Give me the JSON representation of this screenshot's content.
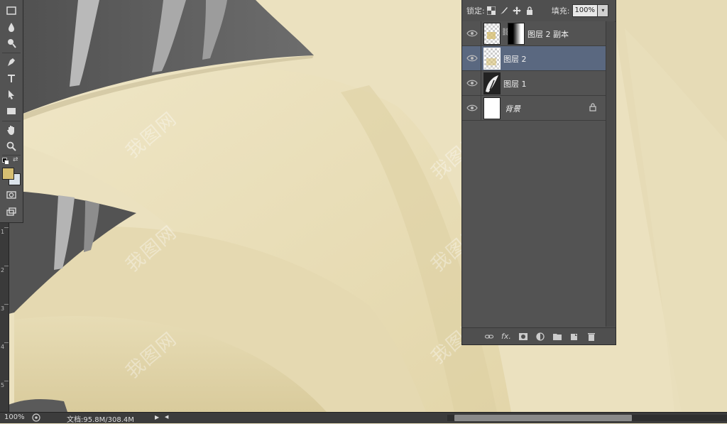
{
  "app": "Photoshop",
  "toolbox": {
    "tools": [
      {
        "name": "rectangle-marquee",
        "glyph": "▭"
      },
      {
        "name": "blur-drop",
        "glyph": "●"
      },
      {
        "name": "dodge",
        "glyph": "◔"
      },
      {
        "name": "pen",
        "glyph": "✒"
      },
      {
        "name": "type",
        "glyph": "T"
      },
      {
        "name": "path-selection",
        "glyph": "➤"
      },
      {
        "name": "rectangle-shape",
        "glyph": "■"
      },
      {
        "name": "hand",
        "glyph": "✋"
      },
      {
        "name": "zoom",
        "glyph": "⚲"
      }
    ],
    "foreground_color": "#d7bf72",
    "background_color": "#dbe3ea"
  },
  "layers_panel": {
    "lock_label": "锁定:",
    "fill_label": "填充:",
    "fill_value": "100%",
    "layers": [
      {
        "name": "图层 2 副本",
        "visible": true,
        "selected": false,
        "has_mask": true,
        "italic": false,
        "locked": false
      },
      {
        "name": "图层 2",
        "visible": true,
        "selected": true,
        "has_mask": false,
        "italic": false,
        "locked": false
      },
      {
        "name": "图层 1",
        "visible": true,
        "selected": false,
        "has_mask": false,
        "italic": false,
        "locked": false
      },
      {
        "name": "背景",
        "visible": true,
        "selected": false,
        "has_mask": false,
        "italic": true,
        "locked": true
      }
    ],
    "footer_buttons": [
      "link-icon",
      "fx-icon",
      "mask-icon",
      "adjustment-icon",
      "folder-icon",
      "new-layer-icon",
      "trash-icon"
    ],
    "footer_fx": "fx."
  },
  "ruler": {
    "labels": [
      "1",
      "2",
      "3",
      "4",
      "5"
    ]
  },
  "status": {
    "zoom": "100%",
    "doc": "文档:95.8M/308.4M"
  },
  "watermark": "我图网",
  "colors": {
    "canvas": "#ebe1bf",
    "panel": "#535353",
    "selected_row": "#5a6880"
  }
}
